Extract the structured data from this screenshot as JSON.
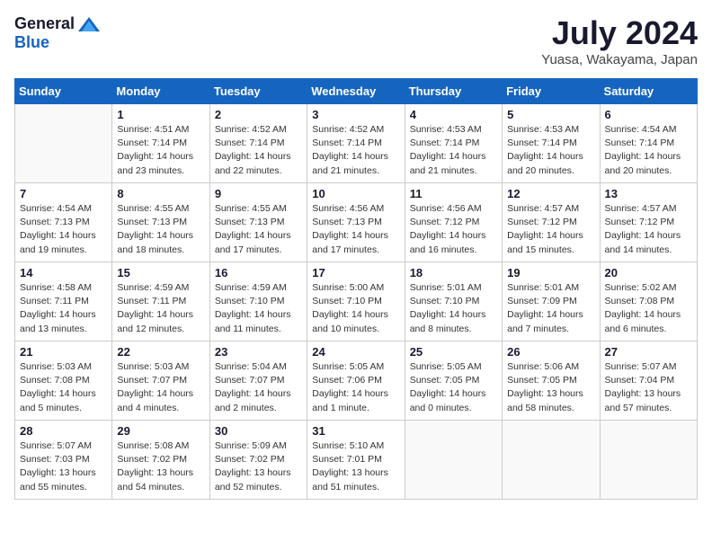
{
  "header": {
    "logo_general": "General",
    "logo_blue": "Blue",
    "month_title": "July 2024",
    "location": "Yuasa, Wakayama, Japan"
  },
  "weekdays": [
    "Sunday",
    "Monday",
    "Tuesday",
    "Wednesday",
    "Thursday",
    "Friday",
    "Saturday"
  ],
  "weeks": [
    [
      {
        "day": "",
        "info": ""
      },
      {
        "day": "1",
        "info": "Sunrise: 4:51 AM\nSunset: 7:14 PM\nDaylight: 14 hours\nand 23 minutes."
      },
      {
        "day": "2",
        "info": "Sunrise: 4:52 AM\nSunset: 7:14 PM\nDaylight: 14 hours\nand 22 minutes."
      },
      {
        "day": "3",
        "info": "Sunrise: 4:52 AM\nSunset: 7:14 PM\nDaylight: 14 hours\nand 21 minutes."
      },
      {
        "day": "4",
        "info": "Sunrise: 4:53 AM\nSunset: 7:14 PM\nDaylight: 14 hours\nand 21 minutes."
      },
      {
        "day": "5",
        "info": "Sunrise: 4:53 AM\nSunset: 7:14 PM\nDaylight: 14 hours\nand 20 minutes."
      },
      {
        "day": "6",
        "info": "Sunrise: 4:54 AM\nSunset: 7:14 PM\nDaylight: 14 hours\nand 20 minutes."
      }
    ],
    [
      {
        "day": "7",
        "info": "Sunrise: 4:54 AM\nSunset: 7:13 PM\nDaylight: 14 hours\nand 19 minutes."
      },
      {
        "day": "8",
        "info": "Sunrise: 4:55 AM\nSunset: 7:13 PM\nDaylight: 14 hours\nand 18 minutes."
      },
      {
        "day": "9",
        "info": "Sunrise: 4:55 AM\nSunset: 7:13 PM\nDaylight: 14 hours\nand 17 minutes."
      },
      {
        "day": "10",
        "info": "Sunrise: 4:56 AM\nSunset: 7:13 PM\nDaylight: 14 hours\nand 17 minutes."
      },
      {
        "day": "11",
        "info": "Sunrise: 4:56 AM\nSunset: 7:12 PM\nDaylight: 14 hours\nand 16 minutes."
      },
      {
        "day": "12",
        "info": "Sunrise: 4:57 AM\nSunset: 7:12 PM\nDaylight: 14 hours\nand 15 minutes."
      },
      {
        "day": "13",
        "info": "Sunrise: 4:57 AM\nSunset: 7:12 PM\nDaylight: 14 hours\nand 14 minutes."
      }
    ],
    [
      {
        "day": "14",
        "info": "Sunrise: 4:58 AM\nSunset: 7:11 PM\nDaylight: 14 hours\nand 13 minutes."
      },
      {
        "day": "15",
        "info": "Sunrise: 4:59 AM\nSunset: 7:11 PM\nDaylight: 14 hours\nand 12 minutes."
      },
      {
        "day": "16",
        "info": "Sunrise: 4:59 AM\nSunset: 7:10 PM\nDaylight: 14 hours\nand 11 minutes."
      },
      {
        "day": "17",
        "info": "Sunrise: 5:00 AM\nSunset: 7:10 PM\nDaylight: 14 hours\nand 10 minutes."
      },
      {
        "day": "18",
        "info": "Sunrise: 5:01 AM\nSunset: 7:10 PM\nDaylight: 14 hours\nand 8 minutes."
      },
      {
        "day": "19",
        "info": "Sunrise: 5:01 AM\nSunset: 7:09 PM\nDaylight: 14 hours\nand 7 minutes."
      },
      {
        "day": "20",
        "info": "Sunrise: 5:02 AM\nSunset: 7:08 PM\nDaylight: 14 hours\nand 6 minutes."
      }
    ],
    [
      {
        "day": "21",
        "info": "Sunrise: 5:03 AM\nSunset: 7:08 PM\nDaylight: 14 hours\nand 5 minutes."
      },
      {
        "day": "22",
        "info": "Sunrise: 5:03 AM\nSunset: 7:07 PM\nDaylight: 14 hours\nand 4 minutes."
      },
      {
        "day": "23",
        "info": "Sunrise: 5:04 AM\nSunset: 7:07 PM\nDaylight: 14 hours\nand 2 minutes."
      },
      {
        "day": "24",
        "info": "Sunrise: 5:05 AM\nSunset: 7:06 PM\nDaylight: 14 hours\nand 1 minute."
      },
      {
        "day": "25",
        "info": "Sunrise: 5:05 AM\nSunset: 7:05 PM\nDaylight: 14 hours\nand 0 minutes."
      },
      {
        "day": "26",
        "info": "Sunrise: 5:06 AM\nSunset: 7:05 PM\nDaylight: 13 hours\nand 58 minutes."
      },
      {
        "day": "27",
        "info": "Sunrise: 5:07 AM\nSunset: 7:04 PM\nDaylight: 13 hours\nand 57 minutes."
      }
    ],
    [
      {
        "day": "28",
        "info": "Sunrise: 5:07 AM\nSunset: 7:03 PM\nDaylight: 13 hours\nand 55 minutes."
      },
      {
        "day": "29",
        "info": "Sunrise: 5:08 AM\nSunset: 7:02 PM\nDaylight: 13 hours\nand 54 minutes."
      },
      {
        "day": "30",
        "info": "Sunrise: 5:09 AM\nSunset: 7:02 PM\nDaylight: 13 hours\nand 52 minutes."
      },
      {
        "day": "31",
        "info": "Sunrise: 5:10 AM\nSunset: 7:01 PM\nDaylight: 13 hours\nand 51 minutes."
      },
      {
        "day": "",
        "info": ""
      },
      {
        "day": "",
        "info": ""
      },
      {
        "day": "",
        "info": ""
      }
    ]
  ]
}
